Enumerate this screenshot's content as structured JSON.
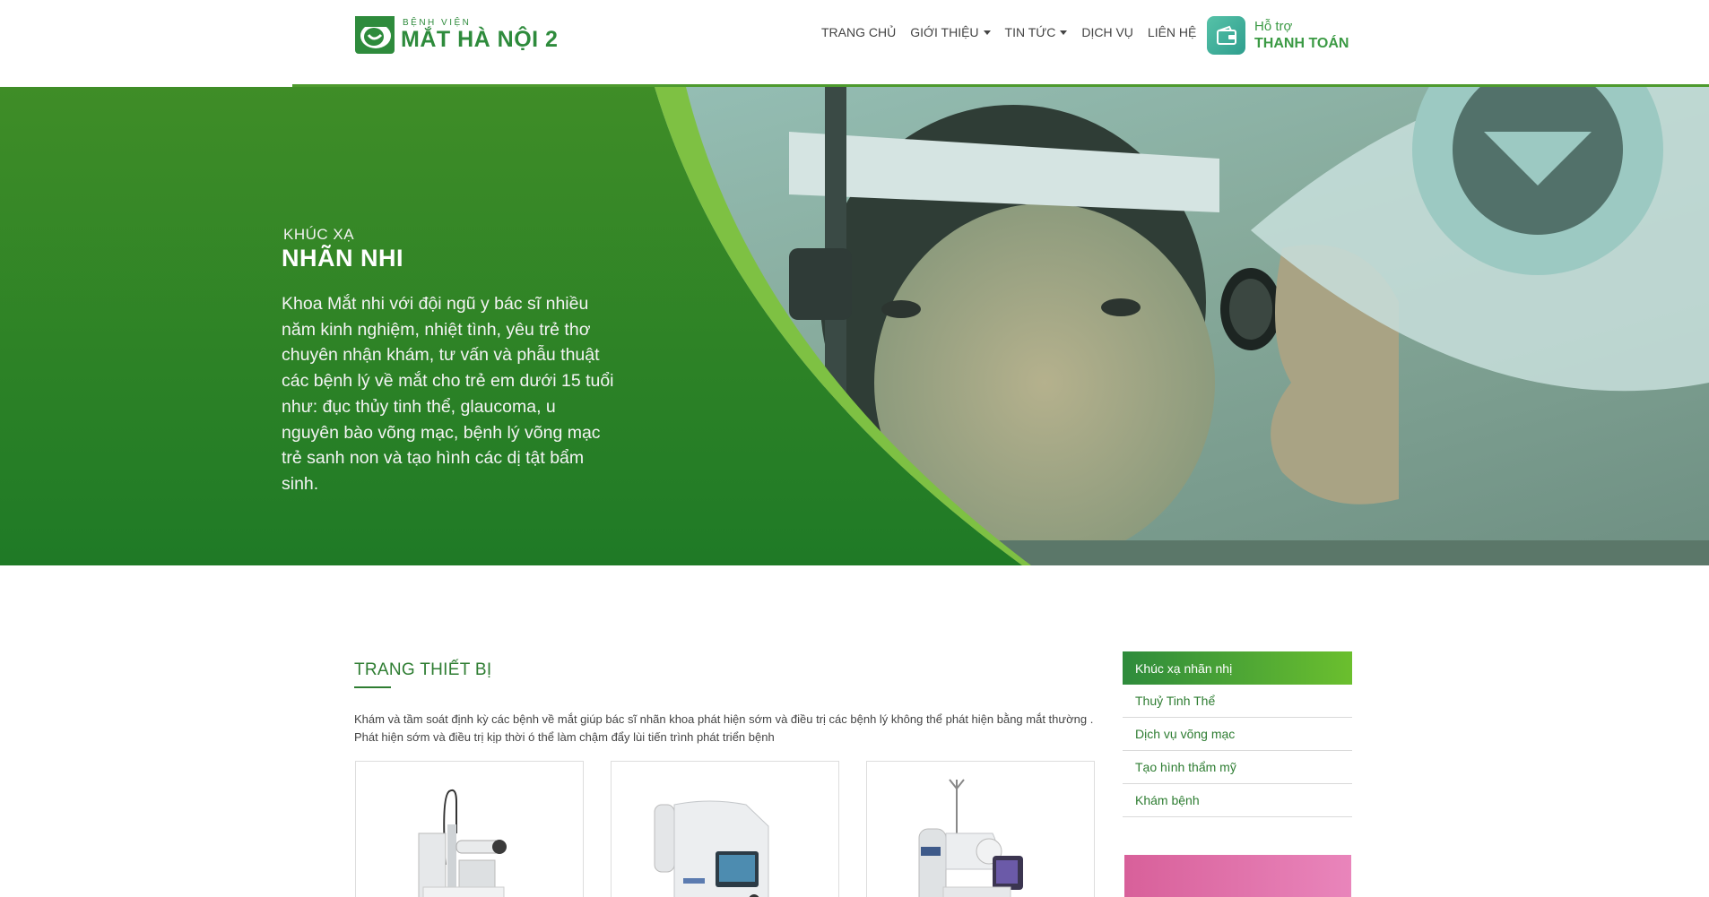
{
  "header": {
    "logo_small": "BỆNH VIỆN",
    "logo_big": "MẮT HÀ NỘI 2",
    "nav": [
      {
        "label": "TRANG CHỦ",
        "dropdown": false
      },
      {
        "label": "GIỚI THIỆU",
        "dropdown": true
      },
      {
        "label": "TIN TỨC",
        "dropdown": true
      },
      {
        "label": "DỊCH VỤ",
        "dropdown": false
      },
      {
        "label": "LIÊN HỆ",
        "dropdown": false
      }
    ],
    "pay_small": "Hỗ trợ",
    "pay_big": "THANH TOÁN",
    "icons": {
      "logo": "eye-logo-icon",
      "pay": "wallet-icon",
      "dropdown": "caret-down-icon"
    }
  },
  "banner": {
    "kicker": "KHÚC XẠ",
    "title": "NHÃN NHI",
    "description": "Khoa Mắt nhi với đội ngũ y bác sĩ nhiều năm kinh nghiệm, nhiệt tình, yêu trẻ thơ chuyên nhận khám, tư vấn và phẫu thuật các bệnh lý về mắt cho trẻ em dưới 15 tuổi như: đục thủy tinh thể, glaucoma, u nguyên bào võng mạc, bệnh lý võng mạc trẻ sanh non và tạo hình các dị tật bẩm sinh."
  },
  "main": {
    "section_title": "TRANG THIẾT BỊ",
    "section_desc": "Khám và tầm soát định kỳ các bệnh về mắt giúp bác sĩ nhãn khoa phát hiện sớm và điều trị các bệnh lý không thể phát hiện bằng mắt thường . Phát hiện sớm và điều trị kịp thời ó thể làm chậm đẩy lùi tiến trình phát triển bệnh",
    "equipment_cards": [
      {
        "name": "slit-lamp-image"
      },
      {
        "name": "autorefractor-image"
      },
      {
        "name": "fundus-camera-image"
      }
    ]
  },
  "sidebar": {
    "items": [
      {
        "label": "Khúc xạ nhãn nhị",
        "active": true
      },
      {
        "label": "Thuỷ Tinh Thể",
        "active": false
      },
      {
        "label": "Dịch vụ võng mạc",
        "active": false
      },
      {
        "label": "Tạo hình thẩm mỹ",
        "active": false
      },
      {
        "label": "Khám bệnh",
        "active": false
      }
    ]
  },
  "colors": {
    "brand_green": "#2e8b3c",
    "banner_green": "#2a7d22",
    "accent_light_green": "#6bbf2e",
    "promo_pink": "#d8609a"
  }
}
